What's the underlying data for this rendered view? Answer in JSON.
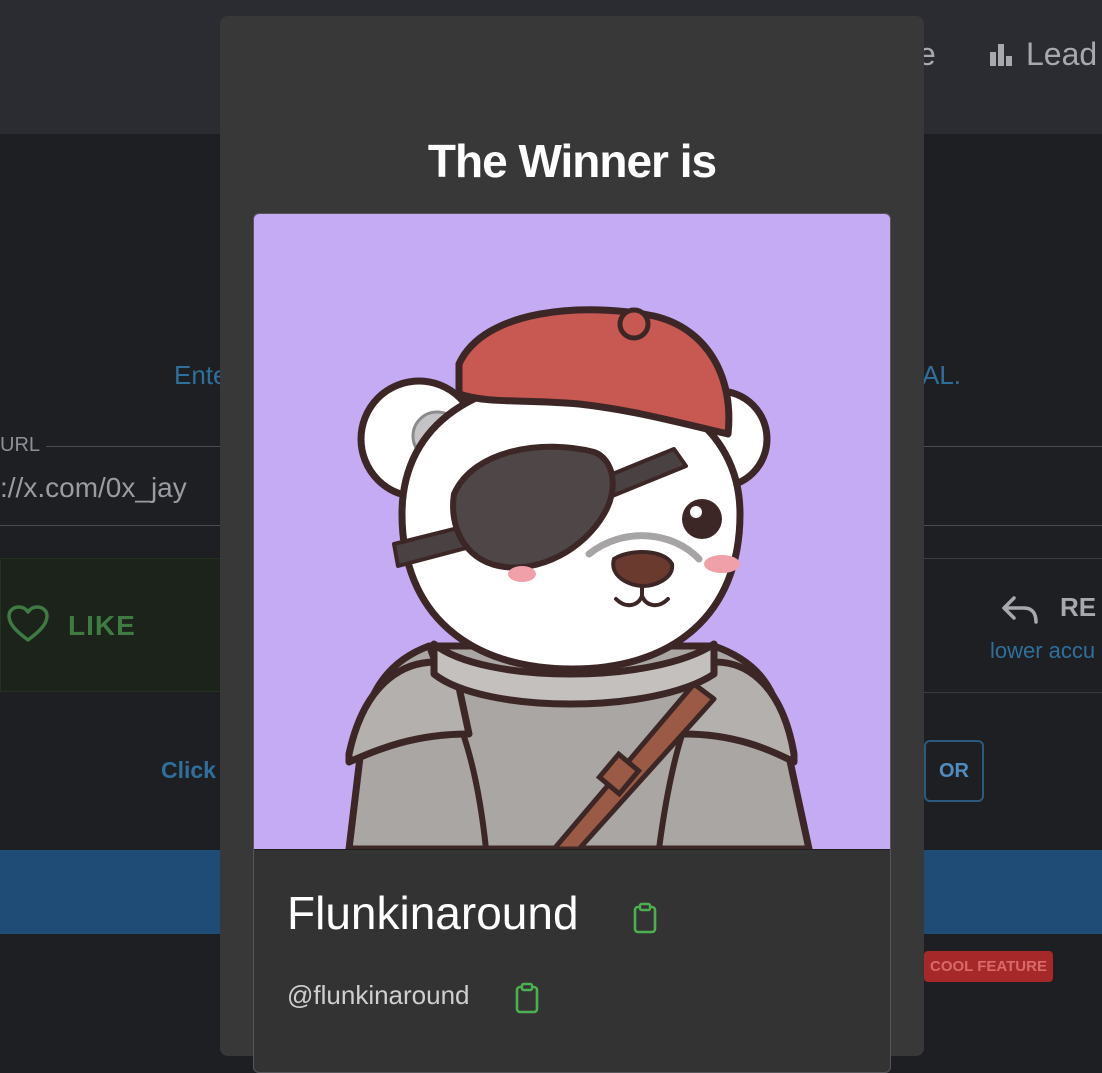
{
  "nav": {
    "partial_item": "e",
    "leaderboard_partial": "Lead"
  },
  "page": {
    "subtitle_left": "Ente",
    "subtitle_right": "AL.",
    "url_label": "URL",
    "url_value": "://x.com/0x_jay",
    "like_label": "LIKE",
    "reply_label": "RE",
    "reply_sub": "lower accu",
    "click_text": "Click",
    "or_button": "OR",
    "cool_badge": "COOL FEATURE"
  },
  "modal": {
    "title": "The Winner is",
    "winner_name": "Flunkinaround",
    "winner_handle": "@flunkinaround"
  },
  "colors": {
    "accent_blue": "#2f6f9c",
    "copy_green": "#4caf50",
    "badge_red": "#a72828",
    "avatar_bg": "#c5abf4",
    "beret_red": "#c75852"
  }
}
